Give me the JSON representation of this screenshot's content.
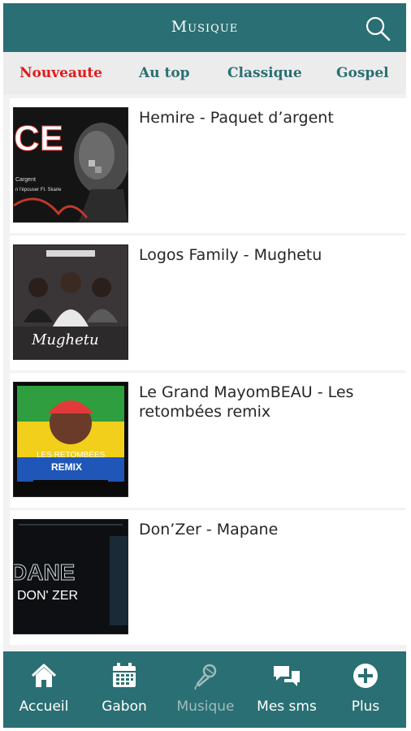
{
  "header": {
    "title": "Musique"
  },
  "tabs": [
    {
      "label": "Nouveaute",
      "active": true
    },
    {
      "label": "Au top"
    },
    {
      "label": "Classique"
    },
    {
      "label": "Gospel"
    }
  ],
  "items": [
    {
      "title": "Hemire - Paquet d’argent",
      "cover_text": [
        "CE",
        "Cargent",
        "n l'épouser Ft. Skarie"
      ]
    },
    {
      "title": "Logos Family - Mughetu",
      "cover_text": [
        "Mughetu"
      ]
    },
    {
      "title": "Le Grand MayomBEAU - Les retombées remix",
      "cover_text": [
        "LES RETOMBÉES",
        "REMIX"
      ]
    },
    {
      "title": "Don’Zer - Mapane",
      "cover_text": [
        "DANE",
        "DON' ZER"
      ]
    }
  ],
  "nav": [
    {
      "label": "Accueil",
      "icon": "home-icon"
    },
    {
      "label": "Gabon",
      "icon": "calendar-icon"
    },
    {
      "label": "Musique",
      "icon": "microphone-icon",
      "active": true
    },
    {
      "label": "Mes sms",
      "icon": "chat-icon"
    },
    {
      "label": "Plus",
      "icon": "plus-circle-icon"
    }
  ],
  "colors": {
    "primary": "#2a6f73",
    "active_tab": "#e21b1b",
    "inactive_nav": "#9fbcbe"
  }
}
